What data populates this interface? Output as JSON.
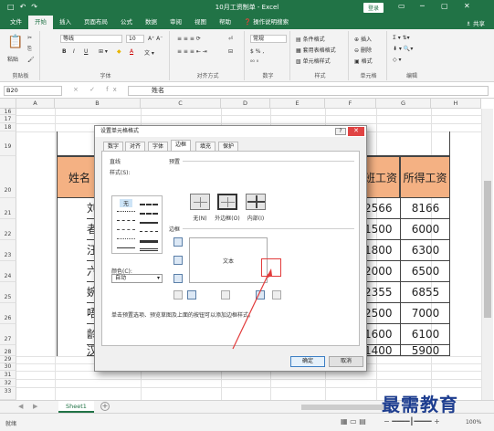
{
  "title_bar": {
    "title": "10月工资制单 - Excel",
    "login": "登录",
    "quick_access": [
      "□",
      "↶",
      "↷"
    ]
  },
  "ribbon_tabs": [
    "文件",
    "开始",
    "插入",
    "页面布局",
    "公式",
    "数据",
    "审阅",
    "视图",
    "帮助",
    "❓ 操作说明搜索"
  ],
  "active_tab": "开始",
  "share": "♗ 共享",
  "ribbon": {
    "clipboard": {
      "label": "剪贴板",
      "paste": "粘贴"
    },
    "font": {
      "label": "字体",
      "font_name": "等线",
      "font_size": "10",
      "bold": "B",
      "italic": "I",
      "underline": "U"
    },
    "alignment": {
      "label": "对齐方式"
    },
    "number": {
      "label": "数字",
      "format": "常规"
    },
    "styles": {
      "label": "样式",
      "cond": "条件格式",
      "table": "套用表格格式",
      "cell": "单元格样式"
    },
    "cells": {
      "label": "单元格",
      "insert": "插入",
      "delete": "删除",
      "format": "格式"
    },
    "editing": {
      "label": "编辑"
    }
  },
  "formula_bar": {
    "name_box": "B20",
    "fx_icons": "× ✓ fx",
    "content": "姓名"
  },
  "columns": [
    "A",
    "B",
    "C",
    "D",
    "E",
    "F",
    "G",
    "H"
  ],
  "rows": [
    "16",
    "17",
    "18",
    "19",
    "20",
    "21",
    "22",
    "23",
    "24",
    "25",
    "26",
    "27",
    "28",
    "29",
    "30",
    "31",
    "32",
    "33"
  ],
  "table": {
    "header_name": "姓名",
    "header_g": "班工资",
    "header_h": "所得工资",
    "names": [
      "刘",
      "者",
      "汪",
      "六",
      "婉",
      "唔",
      "龄",
      "汉"
    ],
    "g_values": [
      "2566",
      "1500",
      "1800",
      "2000",
      "2355",
      "2500",
      "1600",
      "1400"
    ],
    "h_values": [
      "8166",
      "6000",
      "6300",
      "6500",
      "6855",
      "7000",
      "6100",
      "5900"
    ]
  },
  "dialog": {
    "title": "设置单元格格式",
    "tabs": [
      "数字",
      "对齐",
      "字体",
      "边框",
      "填充",
      "保护"
    ],
    "active_tab": "边框",
    "line_label": "直线",
    "style_label": "样式(S):",
    "style_none": "无",
    "color_label": "颜色(C):",
    "color_value": "自动",
    "presets_label": "预置",
    "presets": [
      "无(N)",
      "外边框(O)",
      "内部(I)"
    ],
    "border_label": "边框",
    "preview_text": "文本",
    "hint": "单击预置选项、预览草图及上面的按钮可以添加边框样式。",
    "ok": "确定",
    "cancel": "取消"
  },
  "sheet_tab": "Sheet1",
  "add_sheet": "+",
  "status": "就绪",
  "zoom": "100%",
  "watermark": "最需教育",
  "accent_color": "#217346",
  "header_fill": "#f4b183",
  "arrow_color": "#e23b3b"
}
